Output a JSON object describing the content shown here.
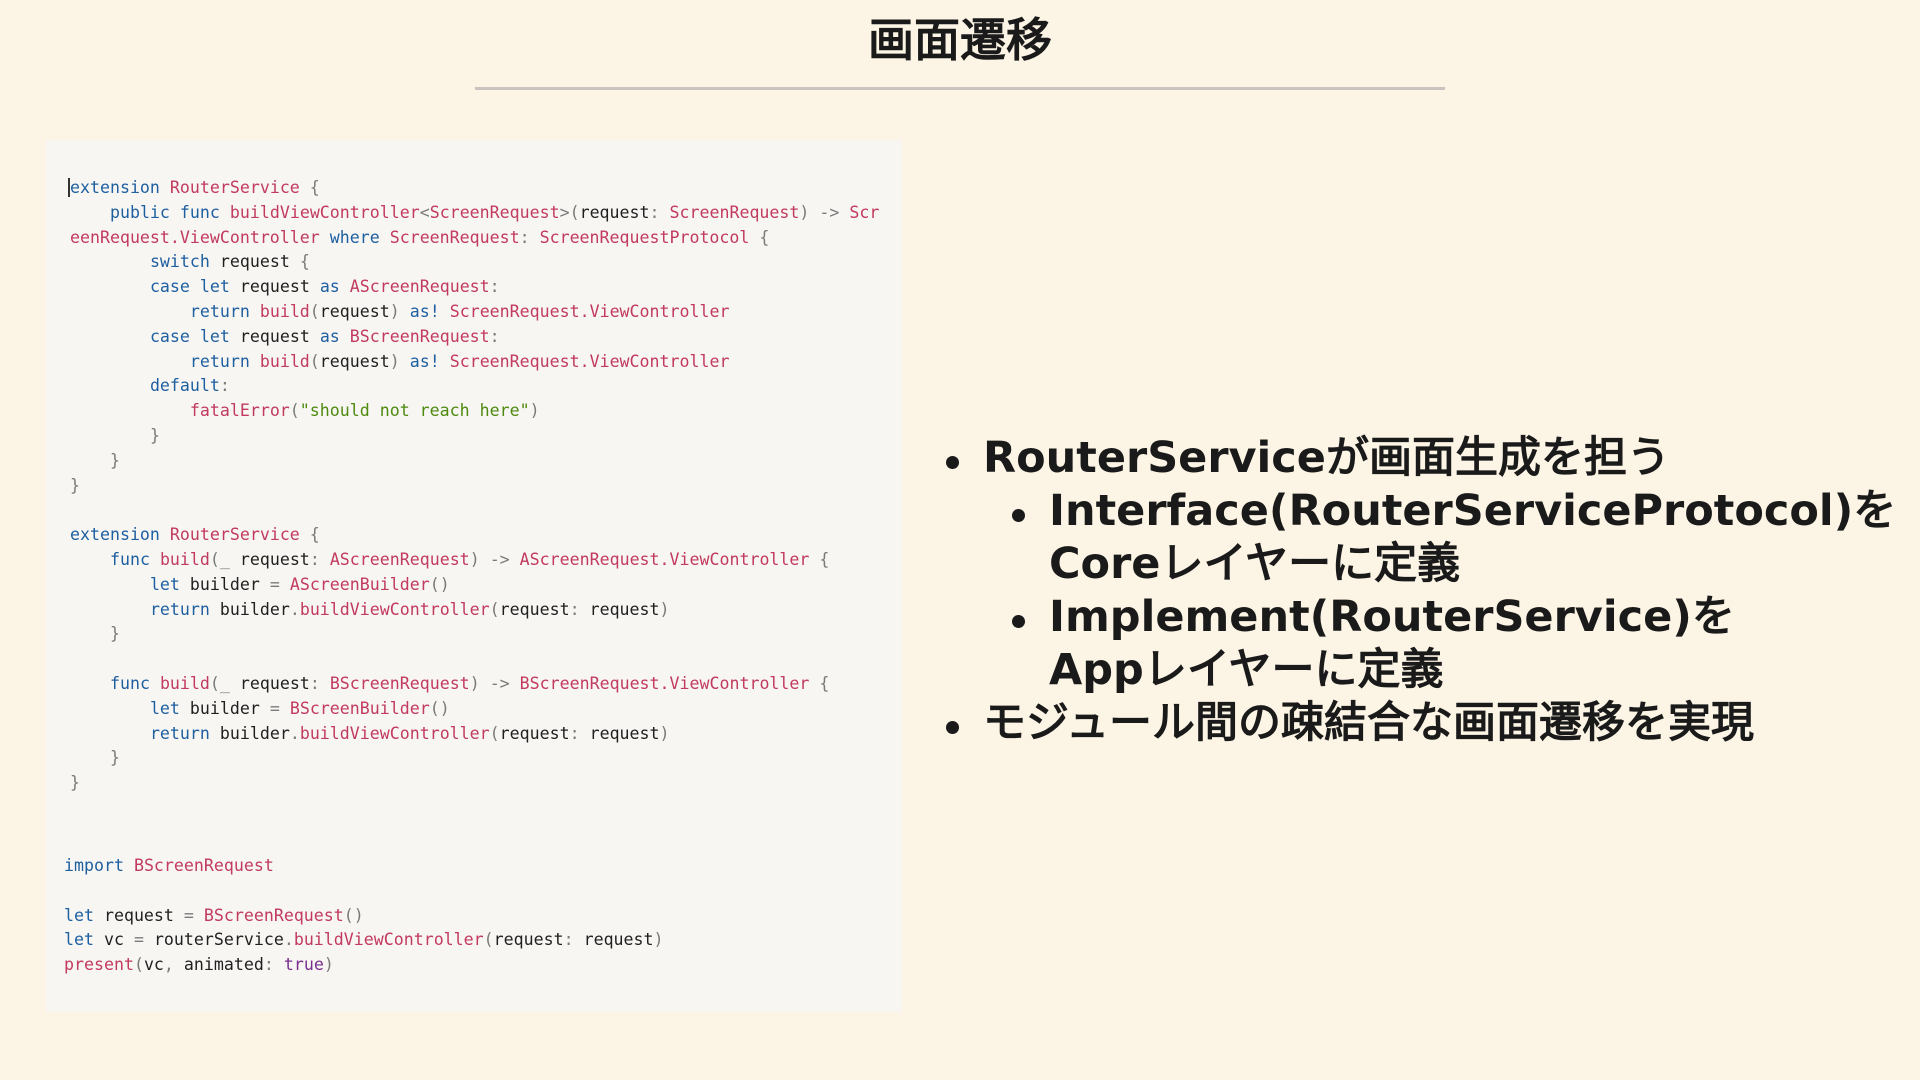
{
  "slide": {
    "title": "画面遷移"
  },
  "code": {
    "block1": [
      [
        [
          "k",
          "extension"
        ],
        [
          "n",
          " "
        ],
        [
          "t",
          "RouterService"
        ],
        [
          "n",
          " "
        ],
        [
          "p",
          "{"
        ]
      ],
      [
        [
          "n",
          "    "
        ],
        [
          "k",
          "public"
        ],
        [
          "n",
          " "
        ],
        [
          "k",
          "func"
        ],
        [
          "n",
          " "
        ],
        [
          "t",
          "buildViewController"
        ],
        [
          "p",
          "<"
        ],
        [
          "t",
          "ScreenRequest"
        ],
        [
          "p",
          ">("
        ],
        [
          "n",
          "request"
        ],
        [
          "p",
          ":"
        ],
        [
          "n",
          " "
        ],
        [
          "t",
          "ScreenRequest"
        ],
        [
          "p",
          ")"
        ],
        [
          "n",
          " "
        ],
        [
          "p",
          "->"
        ],
        [
          "n",
          " "
        ],
        [
          "t",
          "Scr"
        ]
      ],
      [
        [
          "t",
          "eenRequest.ViewController"
        ],
        [
          "n",
          " "
        ],
        [
          "k",
          "where"
        ],
        [
          "n",
          " "
        ],
        [
          "t",
          "ScreenRequest"
        ],
        [
          "p",
          ":"
        ],
        [
          "n",
          " "
        ],
        [
          "t",
          "ScreenRequestProtocol"
        ],
        [
          "n",
          " "
        ],
        [
          "p",
          "{"
        ]
      ],
      [
        [
          "n",
          "        "
        ],
        [
          "k",
          "switch"
        ],
        [
          "n",
          " request "
        ],
        [
          "p",
          "{"
        ]
      ],
      [
        [
          "n",
          "        "
        ],
        [
          "k",
          "case"
        ],
        [
          "n",
          " "
        ],
        [
          "k",
          "let"
        ],
        [
          "n",
          " request "
        ],
        [
          "k",
          "as"
        ],
        [
          "n",
          " "
        ],
        [
          "t",
          "AScreenRequest"
        ],
        [
          "p",
          ":"
        ]
      ],
      [
        [
          "n",
          "            "
        ],
        [
          "k",
          "return"
        ],
        [
          "n",
          " "
        ],
        [
          "t",
          "build"
        ],
        [
          "p",
          "("
        ],
        [
          "n",
          "request"
        ],
        [
          "p",
          ")"
        ],
        [
          "n",
          " "
        ],
        [
          "k",
          "as!"
        ],
        [
          "n",
          " "
        ],
        [
          "t",
          "ScreenRequest.ViewController"
        ]
      ],
      [
        [
          "n",
          "        "
        ],
        [
          "k",
          "case"
        ],
        [
          "n",
          " "
        ],
        [
          "k",
          "let"
        ],
        [
          "n",
          " request "
        ],
        [
          "k",
          "as"
        ],
        [
          "n",
          " "
        ],
        [
          "t",
          "BScreenRequest"
        ],
        [
          "p",
          ":"
        ]
      ],
      [
        [
          "n",
          "            "
        ],
        [
          "k",
          "return"
        ],
        [
          "n",
          " "
        ],
        [
          "t",
          "build"
        ],
        [
          "p",
          "("
        ],
        [
          "n",
          "request"
        ],
        [
          "p",
          ")"
        ],
        [
          "n",
          " "
        ],
        [
          "k",
          "as!"
        ],
        [
          "n",
          " "
        ],
        [
          "t",
          "ScreenRequest.ViewController"
        ]
      ],
      [
        [
          "n",
          "        "
        ],
        [
          "k",
          "default"
        ],
        [
          "p",
          ":"
        ]
      ],
      [
        [
          "n",
          "            "
        ],
        [
          "t",
          "fatalError"
        ],
        [
          "p",
          "("
        ],
        [
          "s",
          "\"should not reach here\""
        ],
        [
          "p",
          ")"
        ]
      ],
      [
        [
          "n",
          "        "
        ],
        [
          "p",
          "}"
        ]
      ],
      [
        [
          "n",
          "    "
        ],
        [
          "p",
          "}"
        ]
      ],
      [
        [
          "p",
          "}"
        ]
      ],
      [
        [
          "n",
          ""
        ]
      ],
      [
        [
          "k",
          "extension"
        ],
        [
          "n",
          " "
        ],
        [
          "t",
          "RouterService"
        ],
        [
          "n",
          " "
        ],
        [
          "p",
          "{"
        ]
      ],
      [
        [
          "n",
          "    "
        ],
        [
          "k",
          "func"
        ],
        [
          "n",
          " "
        ],
        [
          "t",
          "build"
        ],
        [
          "p",
          "(_"
        ],
        [
          "n",
          " request"
        ],
        [
          "p",
          ":"
        ],
        [
          "n",
          " "
        ],
        [
          "t",
          "AScreenRequest"
        ],
        [
          "p",
          ")"
        ],
        [
          "n",
          " "
        ],
        [
          "p",
          "->"
        ],
        [
          "n",
          " "
        ],
        [
          "t",
          "AScreenRequest.ViewController"
        ],
        [
          "n",
          " "
        ],
        [
          "p",
          "{"
        ]
      ],
      [
        [
          "n",
          "        "
        ],
        [
          "k",
          "let"
        ],
        [
          "n",
          " builder "
        ],
        [
          "p",
          "="
        ],
        [
          "n",
          " "
        ],
        [
          "t",
          "AScreenBuilder"
        ],
        [
          "p",
          "()"
        ]
      ],
      [
        [
          "n",
          "        "
        ],
        [
          "k",
          "return"
        ],
        [
          "n",
          " builder"
        ],
        [
          "p",
          "."
        ],
        [
          "t",
          "buildViewController"
        ],
        [
          "p",
          "("
        ],
        [
          "n",
          "request"
        ],
        [
          "p",
          ":"
        ],
        [
          "n",
          " request"
        ],
        [
          "p",
          ")"
        ]
      ],
      [
        [
          "n",
          "    "
        ],
        [
          "p",
          "}"
        ]
      ],
      [
        [
          "n",
          ""
        ]
      ],
      [
        [
          "n",
          "    "
        ],
        [
          "k",
          "func"
        ],
        [
          "n",
          " "
        ],
        [
          "t",
          "build"
        ],
        [
          "p",
          "(_"
        ],
        [
          "n",
          " request"
        ],
        [
          "p",
          ":"
        ],
        [
          "n",
          " "
        ],
        [
          "t",
          "BScreenRequest"
        ],
        [
          "p",
          ")"
        ],
        [
          "n",
          " "
        ],
        [
          "p",
          "->"
        ],
        [
          "n",
          " "
        ],
        [
          "t",
          "BScreenRequest.ViewController"
        ],
        [
          "n",
          " "
        ],
        [
          "p",
          "{"
        ]
      ],
      [
        [
          "n",
          "        "
        ],
        [
          "k",
          "let"
        ],
        [
          "n",
          " builder "
        ],
        [
          "p",
          "="
        ],
        [
          "n",
          " "
        ],
        [
          "t",
          "BScreenBuilder"
        ],
        [
          "p",
          "()"
        ]
      ],
      [
        [
          "n",
          "        "
        ],
        [
          "k",
          "return"
        ],
        [
          "n",
          " builder"
        ],
        [
          "p",
          "."
        ],
        [
          "t",
          "buildViewController"
        ],
        [
          "p",
          "("
        ],
        [
          "n",
          "request"
        ],
        [
          "p",
          ":"
        ],
        [
          "n",
          " request"
        ],
        [
          "p",
          ")"
        ]
      ],
      [
        [
          "n",
          "    "
        ],
        [
          "p",
          "}"
        ]
      ],
      [
        [
          "p",
          "}"
        ]
      ]
    ],
    "block2": [
      [
        [
          "k",
          "import"
        ],
        [
          "n",
          " "
        ],
        [
          "t",
          "BScreenRequest"
        ]
      ],
      [
        [
          "n",
          ""
        ]
      ],
      [
        [
          "k",
          "let"
        ],
        [
          "n",
          " request "
        ],
        [
          "p",
          "="
        ],
        [
          "n",
          " "
        ],
        [
          "t",
          "BScreenRequest"
        ],
        [
          "p",
          "()"
        ]
      ],
      [
        [
          "k",
          "let"
        ],
        [
          "n",
          " vc "
        ],
        [
          "p",
          "="
        ],
        [
          "n",
          " routerService"
        ],
        [
          "p",
          "."
        ],
        [
          "t",
          "buildViewController"
        ],
        [
          "p",
          "("
        ],
        [
          "n",
          "request"
        ],
        [
          "p",
          ":"
        ],
        [
          "n",
          " request"
        ],
        [
          "p",
          ")"
        ]
      ],
      [
        [
          "t",
          "present"
        ],
        [
          "p",
          "("
        ],
        [
          "n",
          "vc"
        ],
        [
          "p",
          ","
        ],
        [
          "n",
          " animated"
        ],
        [
          "p",
          ":"
        ],
        [
          "n",
          " "
        ],
        [
          "b",
          "true"
        ],
        [
          "p",
          ")"
        ]
      ]
    ]
  },
  "bullets": [
    {
      "level": 1,
      "text": "RouterServiceが画面生成を担う"
    },
    {
      "level": 2,
      "text": "Interface(RouterServiceProtocol)を\nCoreレイヤーに定義"
    },
    {
      "level": 2,
      "text": "Implement(RouterService)を\nAppレイヤーに定義"
    },
    {
      "level": 1,
      "text": "モジュール間の疎結合な画面遷移を実現"
    }
  ],
  "colors": {
    "background": "#fcf5e5",
    "code_background": "#f7f6f3",
    "keyword": "#1e5fa0",
    "type": "#c23a5e",
    "string": "#4f8a10"
  }
}
